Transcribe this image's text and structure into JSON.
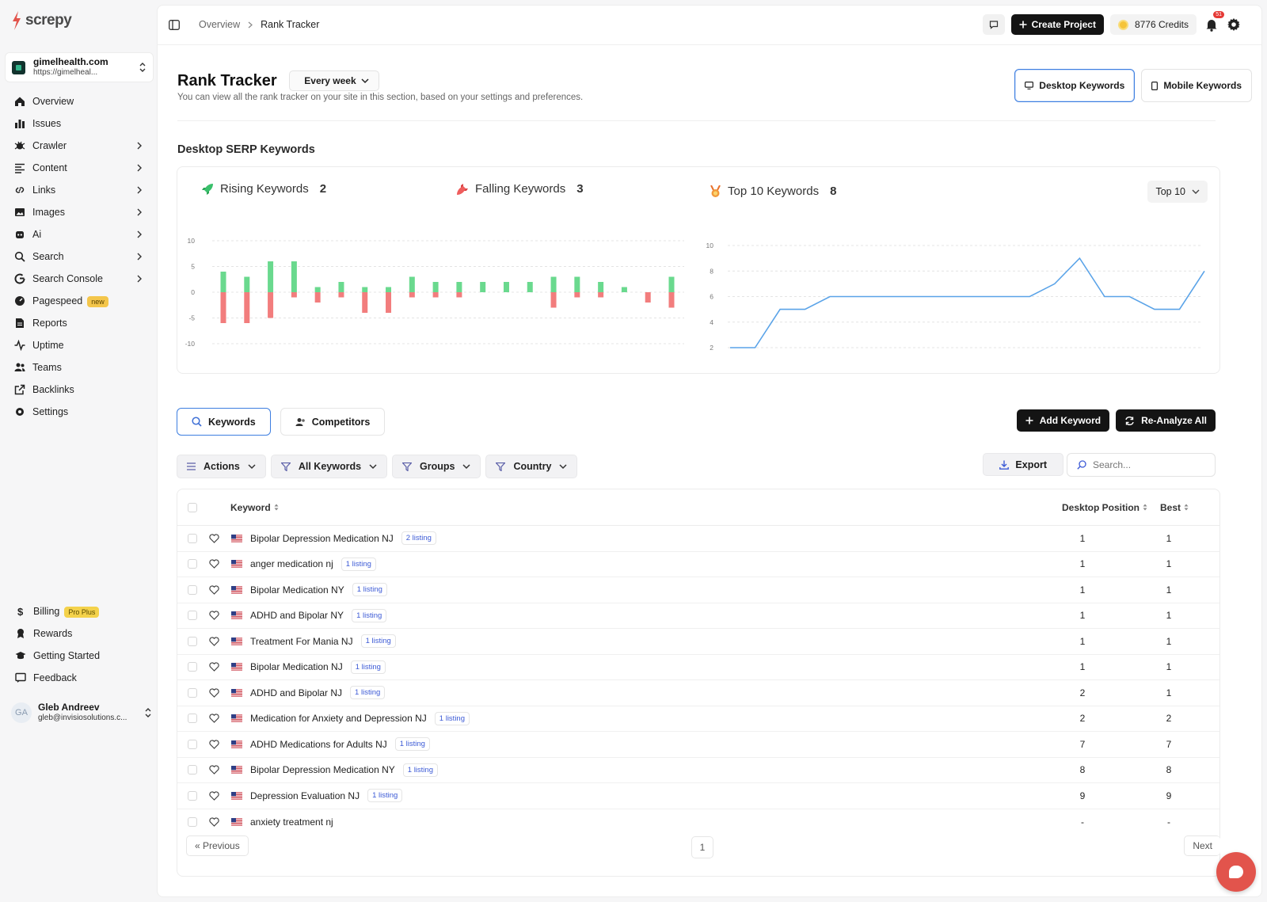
{
  "app": {
    "brand": "screpy"
  },
  "site": {
    "domain": "gimelhealth.com",
    "url": "https://gimelheal..."
  },
  "sidebar": {
    "items": [
      {
        "label": "Overview",
        "icon": "home-icon",
        "arrow": false
      },
      {
        "label": "Issues",
        "icon": "bar-chart-icon",
        "arrow": false
      },
      {
        "label": "Crawler",
        "icon": "bug-icon",
        "arrow": true
      },
      {
        "label": "Content",
        "icon": "text-lines-icon",
        "arrow": true
      },
      {
        "label": "Links",
        "icon": "link-icon",
        "arrow": true
      },
      {
        "label": "Images",
        "icon": "image-icon",
        "arrow": true
      },
      {
        "label": "Ai",
        "icon": "ai-bot-icon",
        "arrow": true
      },
      {
        "label": "Search",
        "icon": "search-icon",
        "arrow": true
      },
      {
        "label": "Search Console",
        "icon": "google-icon",
        "arrow": true
      },
      {
        "label": "Pagespeed",
        "icon": "speed-gauge-icon",
        "arrow": false,
        "badge": "new"
      },
      {
        "label": "Reports",
        "icon": "report-file-icon",
        "arrow": false
      },
      {
        "label": "Uptime",
        "icon": "pulse-icon",
        "arrow": false
      },
      {
        "label": "Teams",
        "icon": "users-icon",
        "arrow": false
      },
      {
        "label": "Backlinks",
        "icon": "external-link-icon",
        "arrow": false
      },
      {
        "label": "Settings",
        "icon": "gear-icon",
        "arrow": false
      }
    ],
    "bottom": [
      {
        "label": "Billing",
        "icon": "dollar-icon",
        "badge": "Pro Plus"
      },
      {
        "label": "Rewards",
        "icon": "award-icon"
      },
      {
        "label": "Getting Started",
        "icon": "graduation-cap-icon"
      },
      {
        "label": "Feedback",
        "icon": "feedback-icon"
      }
    ],
    "user": {
      "initials": "GA",
      "name": "Gleb Andreev",
      "email": "gleb@invisiosolutions.c..."
    }
  },
  "topbar": {
    "breadcrumb": [
      "Overview",
      "Rank Tracker"
    ],
    "create_project": "Create Project",
    "credits": "8776 Credits",
    "notification_count": "51"
  },
  "page": {
    "title": "Rank Tracker",
    "frequency": "Every week",
    "subtitle": "You can view all the rank tracker on your site in this section, based on your settings and preferences.",
    "desktop_keywords": "Desktop Keywords",
    "mobile_keywords": "Mobile Keywords",
    "section_title": "Desktop SERP Keywords"
  },
  "stats": {
    "rising_label": "Rising Keywords",
    "rising_count": "2",
    "falling_label": "Falling Keywords",
    "falling_count": "3",
    "top10_label": "Top 10 Keywords",
    "top10_count": "8",
    "top_select": "Top 10"
  },
  "chart_data": [
    {
      "type": "bar",
      "ylim": [
        -10,
        10
      ],
      "yticks": [
        "10",
        "5",
        "0",
        "-5",
        "-10"
      ],
      "colors": {
        "rising": "#6ad98e",
        "falling": "#f27d7d"
      },
      "series": [
        {
          "values": [
            4,
            3,
            6,
            6,
            1,
            2,
            1,
            1,
            3,
            2,
            2,
            2,
            2,
            2,
            3,
            3,
            2,
            1,
            0,
            3
          ]
        },
        {
          "values": [
            -6,
            -6,
            -5,
            -1,
            -2,
            -1,
            -4,
            -4,
            -1,
            -1,
            -1,
            0,
            0,
            0,
            -3,
            -1,
            -1,
            0,
            -2,
            -3
          ]
        }
      ]
    },
    {
      "type": "line",
      "ylim": [
        2,
        10
      ],
      "yticks": [
        "10",
        "8",
        "6",
        "4",
        "2"
      ],
      "color": "#5aa3e8",
      "values": [
        2,
        2,
        5,
        5,
        6,
        6,
        6,
        6,
        6,
        6,
        6,
        6,
        6,
        7,
        9,
        6,
        6,
        5,
        5,
        8
      ]
    }
  ],
  "table_tabs": {
    "keywords": "Keywords",
    "competitors": "Competitors"
  },
  "buttons": {
    "add_keyword": "Add Keyword",
    "reanalyze": "Re-Analyze All",
    "export": "Export"
  },
  "filters": {
    "actions": "Actions",
    "all_keywords": "All Keywords",
    "groups": "Groups",
    "country": "Country"
  },
  "search": {
    "placeholder": "Search..."
  },
  "table": {
    "headers": {
      "keyword": "Keyword",
      "position": "Desktop Position",
      "best": "Best"
    },
    "rows": [
      {
        "keyword": "Bipolar Depression Medication NJ",
        "listing": "2 listing",
        "position": "1",
        "best": "1"
      },
      {
        "keyword": "anger medication nj",
        "listing": "1 listing",
        "position": "1",
        "best": "1"
      },
      {
        "keyword": "Bipolar Medication NY",
        "listing": "1 listing",
        "position": "1",
        "best": "1"
      },
      {
        "keyword": "ADHD and Bipolar NY",
        "listing": "1 listing",
        "position": "1",
        "best": "1"
      },
      {
        "keyword": "Treatment For Mania NJ",
        "listing": "1 listing",
        "position": "1",
        "best": "1"
      },
      {
        "keyword": "Bipolar Medication NJ",
        "listing": "1 listing",
        "position": "1",
        "best": "1"
      },
      {
        "keyword": "ADHD and Bipolar NJ",
        "listing": "1 listing",
        "position": "2",
        "best": "1"
      },
      {
        "keyword": "Medication for Anxiety and Depression NJ",
        "listing": "1 listing",
        "position": "2",
        "best": "2"
      },
      {
        "keyword": "ADHD Medications for Adults NJ",
        "listing": "1 listing",
        "position": "7",
        "best": "7"
      },
      {
        "keyword": "Bipolar Depression Medication NY",
        "listing": "1 listing",
        "position": "8",
        "best": "8"
      },
      {
        "keyword": "Depression Evaluation NJ",
        "listing": "1 listing",
        "position": "9",
        "best": "9"
      },
      {
        "keyword": "anxiety treatment nj",
        "listing": "",
        "position": "-",
        "best": "-"
      }
    ]
  },
  "pagination": {
    "prev": "« Previous",
    "page": "1",
    "next": "Next"
  }
}
